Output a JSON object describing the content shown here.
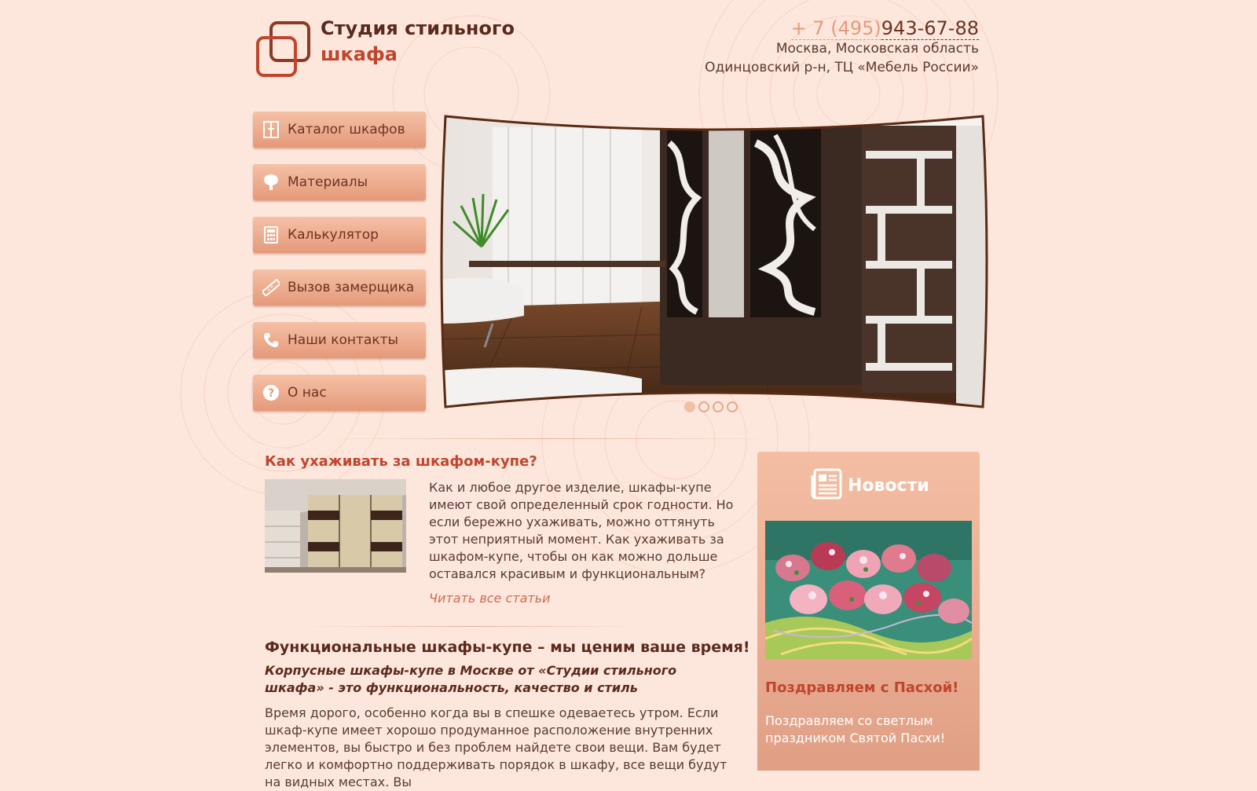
{
  "brand": {
    "line1": "Студия стильного",
    "line2": "шкафа"
  },
  "contacts": {
    "phone_code": "+ 7 (495)",
    "phone_number": "943-67-88",
    "address_line1": "Москва, Московская область",
    "address_line2": "Одинцовский р-н, ТЦ «Мебель России»"
  },
  "menu": {
    "items": [
      {
        "label": "Каталог шкафов",
        "icon": "wardrobe-icon"
      },
      {
        "label": "Материалы",
        "icon": "tree-icon"
      },
      {
        "label": "Калькулятор",
        "icon": "calculator-icon"
      },
      {
        "label": "Вызов замерщика",
        "icon": "ruler-icon"
      },
      {
        "label": "Наши контакты",
        "icon": "phone-icon"
      },
      {
        "label": "О нас",
        "icon": "question-icon"
      }
    ]
  },
  "slider": {
    "slide_count": 4,
    "active_index": 0
  },
  "article": {
    "title": "Как ухаживать за шкафом-купе?",
    "text": "Как и любое другое изделие, шкафы-купе имеют свой определенный срок годности. Но если бережно ухаживать, можно оттянуть этот неприятный момент. Как ухаживать за шкафом-купе, чтобы он как можно дольше оставался красивым и функциональным?",
    "link": "Читать все статьи"
  },
  "functional": {
    "title": "Функциональные шкафы-купе – мы ценим ваше время!",
    "subtitle": "Корпусные шкафы-купе в Москве от «Студии стильного шкафа» - это функциональность, качество и стиль",
    "text": "Время дорого, особенно когда вы в спешке одеваетесь утром. Если шкаф-купе имеет хорошо продуманное расположение внутренних элементов, вы быстро и без проблем найдете свои вещи. Вам будет легко и комфортно поддерживать порядок в шкафу, все вещи будут на видных местах. Вы"
  },
  "news": {
    "title": "Новости",
    "item_title": "Поздравляем с Пасхой!",
    "item_text": "Поздравляем со светлым праздником Святой Пасхи!"
  },
  "colors": {
    "background": "#fde7dc",
    "accent": "#c0452e",
    "dark_brown": "#5b2a1d",
    "menu_gradient_top": "#f5c1a6",
    "menu_gradient_bottom": "#e5997a"
  }
}
